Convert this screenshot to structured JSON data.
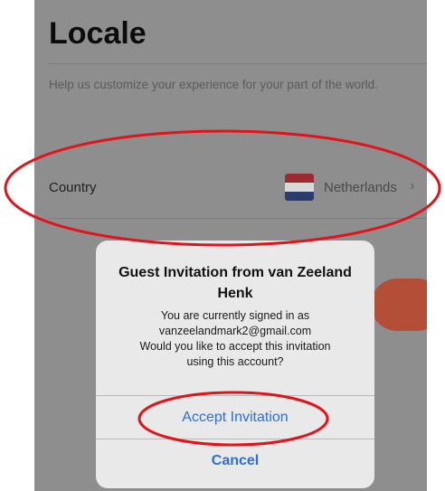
{
  "page": {
    "title": "Locale",
    "help_text": "Help us customize your experience for your part of the world."
  },
  "country_row": {
    "label": "Country",
    "value": "Netherlands",
    "flag_icon": "netherlands-flag-icon",
    "chevron_icon": "chevron-right-icon"
  },
  "dialog": {
    "title": "Guest Invitation from van Zeeland Henk",
    "message_lines": [
      "You are currently signed in as",
      "vanzeelandmark2@gmail.com",
      "Would you like to accept this invitation",
      "using this account?"
    ],
    "accept_label": "Accept Invitation",
    "cancel_label": "Cancel"
  },
  "colors": {
    "accent": "#2d6fd6",
    "annotation": "#e0141a",
    "background_button": "#b34f37"
  }
}
